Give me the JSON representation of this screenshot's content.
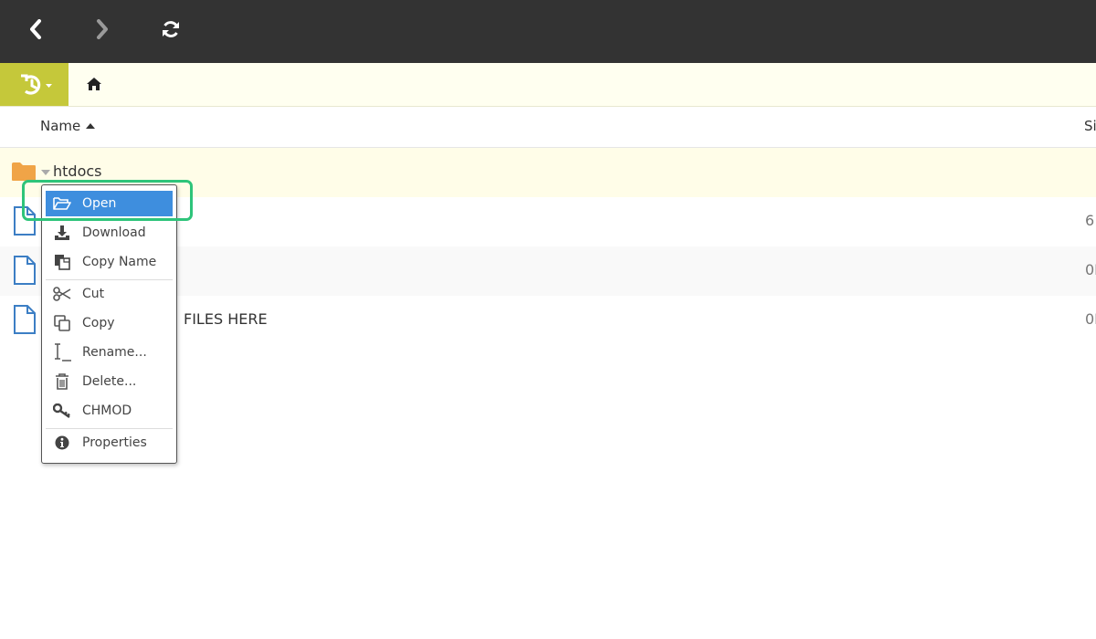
{
  "toolbar": {
    "back_icon": "chevron-left-icon",
    "forward_icon": "chevron-right-icon",
    "refresh_icon": "refresh-icon"
  },
  "pathbar": {
    "history_icon": "history-icon",
    "home_icon": "home-icon"
  },
  "columns": {
    "name_label": "Name",
    "size_label": "Si"
  },
  "rows": [
    {
      "name": "htdocs",
      "type": "folder",
      "size": ""
    },
    {
      "name": "",
      "type": "file",
      "size": "6"
    },
    {
      "name": "",
      "type": "file",
      "size": "0I"
    },
    {
      "name": "FILES HERE",
      "type": "file",
      "size": "0I"
    }
  ],
  "context_menu": {
    "items": [
      {
        "label": "Open",
        "icon": "folder-open-icon"
      },
      {
        "label": "Download",
        "icon": "download-icon"
      },
      {
        "label": "Copy Name",
        "icon": "copy-name-icon"
      },
      {
        "label": "Cut",
        "icon": "scissors-icon"
      },
      {
        "label": "Copy",
        "icon": "copy-icon"
      },
      {
        "label": "Rename...",
        "icon": "rename-cursor-icon"
      },
      {
        "label": "Delete...",
        "icon": "trash-icon"
      },
      {
        "label": "CHMOD",
        "icon": "key-icon"
      },
      {
        "label": "Properties",
        "icon": "info-icon"
      }
    ]
  },
  "colors": {
    "topbar": "#333333",
    "history_button": "#c5c83a",
    "selected_row": "#fffde8",
    "menu_active": "#3e8ede",
    "highlight_ring": "#2ec47a",
    "folder": "#f0a447",
    "file_icon": "#3c7ec4"
  }
}
